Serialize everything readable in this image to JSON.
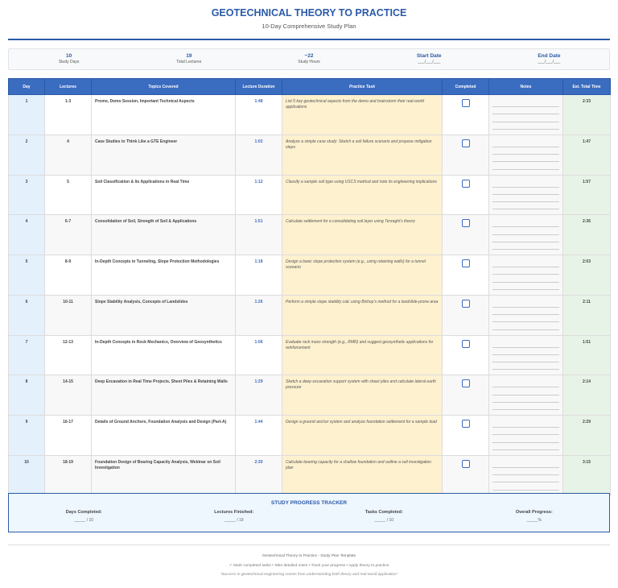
{
  "header": {
    "title": "GEOTECHNICAL THEORY TO PRACTICE",
    "subtitle": "10-Day Comprehensive Study Plan"
  },
  "stats": [
    {
      "value": "10",
      "label": "Study Days"
    },
    {
      "value": "19",
      "label": "Total Lectures"
    },
    {
      "value": "~22",
      "label": "Study Hours"
    },
    {
      "value": "Start Date",
      "label": "___/___/___"
    },
    {
      "value": "End Date",
      "label": "___/___/___"
    }
  ],
  "table": {
    "columns": [
      "Day",
      "Lectures",
      "Topics Covered",
      "Lecture Duration",
      "Practice Task",
      "Completed",
      "Notes",
      "Est. Total Time"
    ],
    "rows": [
      {
        "day": "1",
        "lectures": "1-3",
        "topic": "Promo, Demo Session, Important Technical Aspects",
        "duration": "1:48",
        "task": "List 5 key geotechnical aspects from the demo and brainstorm their real-world applications",
        "total": "2:33"
      },
      {
        "day": "2",
        "lectures": "4",
        "topic": "Case Studies to Think Like a GTE Engineer",
        "duration": "1:02",
        "task": "Analyze a simple case study: Sketch a soil failure scenario and propose mitigation steps",
        "total": "1:47"
      },
      {
        "day": "3",
        "lectures": "5",
        "topic": "Soil Classification & Its Applications in Real Time",
        "duration": "1:12",
        "task": "Classify a sample soil type using USCS method and note its engineering implications",
        "total": "1:57"
      },
      {
        "day": "4",
        "lectures": "6-7",
        "topic": "Consolidation of Soil, Strength of Soil & Applications",
        "duration": "1:51",
        "task": "Calculate settlement for a consolidating soil layer using Terzaghi's theory",
        "total": "2:36"
      },
      {
        "day": "5",
        "lectures": "8-9",
        "topic": "In-Depth Concepts in Tunneling, Slope Protection Methodologies",
        "duration": "1:18",
        "task": "Design a basic slope protection system (e.g., using retaining walls) for a tunnel scenario",
        "total": "2:03"
      },
      {
        "day": "6",
        "lectures": "10-11",
        "topic": "Slope Stability Analysis, Concepts of Landslides",
        "duration": "1:26",
        "task": "Perform a simple slope stability calc using Bishop's method for a landslide-prone area",
        "total": "2:11"
      },
      {
        "day": "7",
        "lectures": "12-13",
        "topic": "In-Depth Concepts in Rock Mechanics, Overview of Geosynthetics",
        "duration": "1:06",
        "task": "Evaluate rock mass strength (e.g., RMR) and suggest geosynthetic applications for reinforcement",
        "total": "1:51"
      },
      {
        "day": "8",
        "lectures": "14-15",
        "topic": "Deep Excavation in Real Time Projects, Sheet Piles & Retaining Walls",
        "duration": "1:29",
        "task": "Sketch a deep excavation support system with sheet piles and calculate lateral earth pressure",
        "total": "2:14"
      },
      {
        "day": "9",
        "lectures": "16-17",
        "topic": "Details of Ground Anchors, Foundation Analysis and Design (Part-A)",
        "duration": "1:44",
        "task": "Design a ground anchor system and analyze foundation settlement for a sample load",
        "total": "2:29"
      },
      {
        "day": "10",
        "lectures": "18-19",
        "topic": "Foundation Design of Bearing Capacity Analysis, Webinar on Soil Investigation",
        "duration": "2:30",
        "task": "Calculate bearing capacity for a shallow foundation and outline a soil investigation plan",
        "total": "3:15"
      }
    ]
  },
  "tracker": {
    "title": "STUDY PROGRESS TRACKER",
    "items": [
      {
        "label": "Days Completed:",
        "value": "_____ / 10"
      },
      {
        "label": "Lectures Finished:",
        "value": "_____ / 19"
      },
      {
        "label": "Tasks Completed:",
        "value": "_____ / 10"
      },
      {
        "label": "Overall Progress:",
        "value": "_____%"
      }
    ]
  },
  "footer": {
    "line1": "Geotechnical Theory to Practice - Study Plan Template",
    "line2": "✓ Mark completed tasks • Take detailed notes • Track your progress • Apply theory to practice",
    "line3": "\"Success in geotechnical engineering comes from understanding both theory and real-world application\""
  },
  "colors": {
    "accent": "#2b5aa8",
    "header_bg": "#3a6cc0",
    "task_bg": "#fdf1cf",
    "day_bg": "#e4f1fc",
    "total_bg": "#e8f3e8"
  }
}
